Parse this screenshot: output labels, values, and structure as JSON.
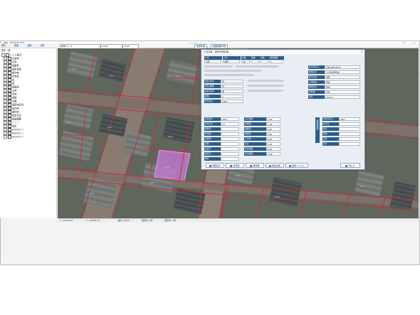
{
  "window": {
    "title": "農家基本台帳システム",
    "controls": [
      "–",
      "□",
      "✕"
    ]
  },
  "ribbon": {
    "tabs": [
      "地図",
      "検索",
      "台帳",
      "印刷",
      "地図編集",
      "固定資産",
      "地図設定"
    ],
    "buttons": [
      {
        "label": "拡大",
        "icon": "zoom-in-icon",
        "color": "#3b6fb5"
      },
      {
        "label": "縮小",
        "icon": "zoom-out-icon",
        "color": "#3b6fb5"
      },
      {
        "label": "連続ズーム",
        "icon": "zoom-icon",
        "color": "#4b7bc4"
      },
      {
        "label": "移動",
        "icon": "hand-icon",
        "color": "#6c8fb5"
      },
      {
        "label": "全体表示",
        "icon": "globe-icon",
        "color": "#2f6ebd"
      },
      {
        "label": "情報表示",
        "icon": "info-icon",
        "color": "#1f7ad6"
      },
      {
        "label": "行政区画表示",
        "icon": "info-icon",
        "color": "#1f7ad6"
      },
      {
        "label": "選択解除",
        "icon": "clear-icon",
        "color": "#d23a3a"
      },
      {
        "label": "お気に入り",
        "icon": "star-icon",
        "color": "#f2b01e"
      }
    ],
    "checkboxes": [
      "凡例表示",
      "地番表示",
      "縮尺表示"
    ],
    "groups": [
      "地図操作",
      "情報",
      "画面"
    ]
  },
  "left_panel": {
    "tabs": [
      "表示",
      "検索",
      "台帳",
      "凡例"
    ],
    "header": "表示一覧",
    "items": [
      "レイヤ表示",
      "行政界",
      "字界",
      "地番界",
      "農家台帳",
      "耕作者",
      "所有者",
      "田",
      "畑",
      "樹園地",
      "山林",
      "宅地",
      "道路",
      "水路",
      "農用地区域",
      "転作地",
      "遊休地",
      "航空写真",
      "基盤整備",
      "ゾーン",
      "地区",
      "H29オルソ",
      "H26オルソ",
      "H23オルソ"
    ]
  },
  "map_toolbar": {
    "layer_select": "標準マップ",
    "scale_select": "1/500",
    "zoom_select": "100%",
    "buttons": [
      "地図印刷",
      "範囲図面印刷"
    ]
  },
  "status_bar": {
    "texts": [
      "X: 12345.67",
      "Y: -23456.78",
      "縮尺 1/500",
      "座標系 Ⅸ系",
      "選択中: 1筆"
    ]
  },
  "dialog": {
    "title": "土地台帳 - 筆別詳細情報",
    "header_labels": [
      "大字",
      "小字",
      "本番",
      "枝番",
      "孫番",
      "耕作面積"
    ],
    "header_values": [
      "宮崎",
      "本郷",
      "08",
      "",
      "",
      "1"
    ],
    "fields_left": [
      {
        "label": "地目(登記)",
        "value": "田"
      },
      {
        "label": "地目(課税)",
        "value": "田"
      },
      {
        "label": "地目(現況)",
        "value": "畑"
      },
      {
        "label": "面積",
        "value": "1"
      },
      {
        "label": "所有区分",
        "value": "100%"
      }
    ],
    "fields_right": [
      {
        "label": "登記年月日",
        "value": "平成18年4月1日"
      },
      {
        "label": "農振区分",
        "value": "その他(農振無)"
      },
      {
        "label": "都市計画",
        "value": "調整"
      },
      {
        "label": "土地改良",
        "value": "農業"
      },
      {
        "label": "耕作区分",
        "value": "耕作"
      },
      {
        "label": "所有権",
        "value": "自作"
      },
      {
        "label": "番号",
        "value": "0013-4"
      }
    ],
    "section2_left": [
      {
        "label": "農家番号",
        "value": "3003"
      },
      {
        "label": "世帯主名",
        "value": "10"
      },
      {
        "label": "耕作者",
        "value": ""
      },
      {
        "label": "利用権",
        "value": ""
      },
      {
        "label": "賃借料",
        "value": ""
      },
      {
        "label": "期間",
        "value": ""
      },
      {
        "label": "設定日",
        "value": ""
      },
      {
        "label": "終期日",
        "value": ""
      },
      {
        "label": "備考",
        "value": ""
      }
    ],
    "section2_mid": [
      {
        "label": "小計面積",
        "value": "1.00"
      },
      {
        "label": "田面積",
        "value": "1.00"
      },
      {
        "label": "畑面積",
        "value": "0.00"
      },
      {
        "label": "樹園地",
        "value": "0.00"
      },
      {
        "label": "その他",
        "value": "0.00"
      },
      {
        "label": "合計",
        "value": "1.00"
      },
      {
        "label": "転作面積",
        "value": "0.00"
      },
      {
        "label": "作付面積",
        "value": "0.00"
      }
    ],
    "section2_right": [
      {
        "label": "申請年月日",
        "value": "2021"
      },
      {
        "label": "許可日",
        "value": ""
      },
      {
        "label": "番号",
        "value": ""
      },
      {
        "label": "期限",
        "value": ""
      },
      {
        "label": "更新",
        "value": ""
      },
      {
        "label": "区分",
        "value": ""
      }
    ],
    "vertical_tab": "利用権設定",
    "footer_buttons": [
      "地図表示",
      "所有者",
      "耕作者",
      "農地台帳",
      "関連ファイル",
      "閉じる"
    ]
  },
  "colors": {
    "label_bg": "#2f5d8a",
    "parcel_line": "#d0263a",
    "highlight": "#c879d8",
    "dialog_bg": "#e9eef4"
  }
}
